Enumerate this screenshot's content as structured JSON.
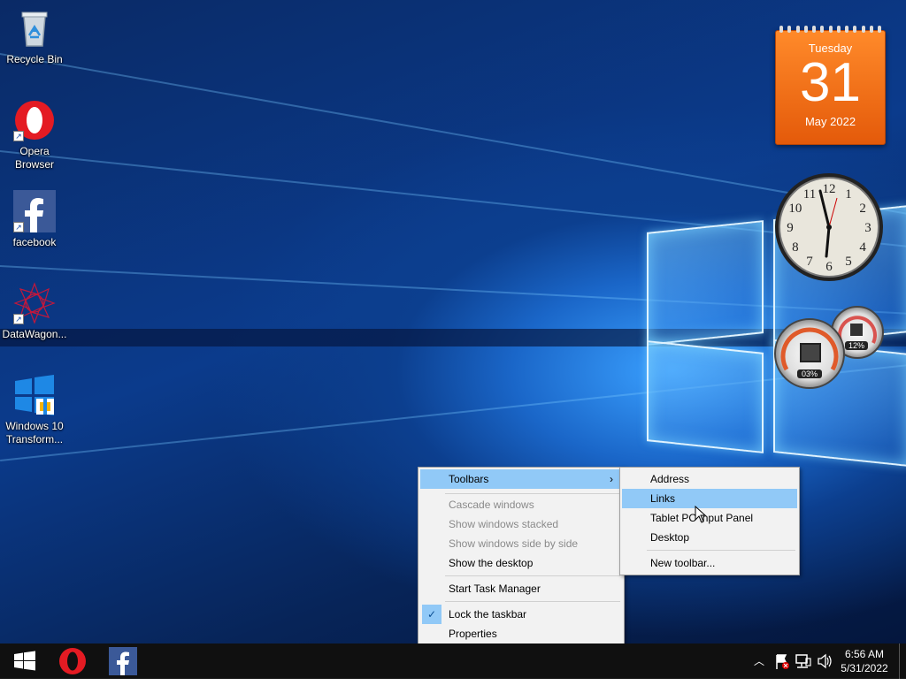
{
  "desktop": {
    "icons": [
      {
        "label": "Recycle Bin",
        "icon": "recycle-bin-icon"
      },
      {
        "label": "Opera Browser",
        "icon": "opera-icon"
      },
      {
        "label": "facebook",
        "icon": "facebook-icon"
      },
      {
        "label": "DataWagon...",
        "icon": "datawagon-icon"
      },
      {
        "label": "Windows 10 Transform...",
        "icon": "windows-transform-icon"
      }
    ]
  },
  "gadgets": {
    "calendar": {
      "weekday": "Tuesday",
      "day": "31",
      "month_year": "May 2022"
    },
    "clock": {
      "numbers": [
        "12",
        "1",
        "2",
        "3",
        "4",
        "5",
        "6",
        "7",
        "8",
        "9",
        "10",
        "11"
      ]
    },
    "meter": {
      "cpu": "03%",
      "ram": "12%"
    }
  },
  "context_menu": {
    "items": [
      {
        "label": "Toolbars",
        "state": "highlighted",
        "submenu": true
      },
      {
        "label": "Cascade windows",
        "state": "disabled"
      },
      {
        "label": "Show windows stacked",
        "state": "disabled"
      },
      {
        "label": "Show windows side by side",
        "state": "disabled"
      },
      {
        "label": "Show the desktop",
        "state": "normal"
      },
      {
        "label": "Start Task Manager",
        "state": "normal"
      },
      {
        "label": "Lock the taskbar",
        "state": "checked"
      },
      {
        "label": "Properties",
        "state": "normal"
      }
    ],
    "submenu": [
      {
        "label": "Address"
      },
      {
        "label": "Links",
        "state": "highlighted"
      },
      {
        "label": "Tablet PC Input Panel"
      },
      {
        "label": "Desktop"
      },
      {
        "label": "New toolbar..."
      }
    ]
  },
  "taskbar": {
    "pinned": [
      "windows-start-icon",
      "opera-icon",
      "facebook-icon"
    ],
    "tray_icons": [
      "chevron-up-icon",
      "action-center-flag-icon",
      "network-icon",
      "volume-icon"
    ],
    "time": "6:56 AM",
    "date": "5/31/2022"
  },
  "colors": {
    "menu_highlight": "#91c9f7",
    "calendar_orange": "#f07020",
    "taskbar": "#101010"
  }
}
